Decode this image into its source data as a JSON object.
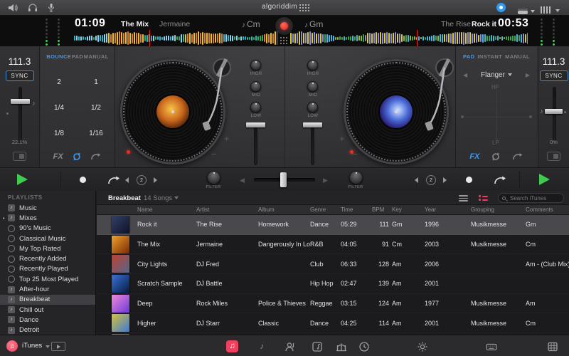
{
  "titlebar": {
    "logo_text": "algoriddim",
    "left_icons": [
      "volume-icon",
      "headphones-icon",
      "mic-icon"
    ],
    "right_icons": [
      "blue-status-icon",
      "deck-view-toggle-icon",
      "mixer-columns-icon"
    ]
  },
  "deck_a": {
    "elapsed": "01:09",
    "title": "The Mix",
    "artist": "Jermaine",
    "key": "Cm",
    "key_note": "♪",
    "bpm": "111.3",
    "sync_label": "SYNC",
    "pitch_percent": "22.1%",
    "pad_tabs": [
      "BOUNCE",
      "PAD",
      "MANUAL"
    ],
    "active_tab": "BOUNCE",
    "loop_grid": [
      "2",
      "1",
      "1/4",
      "1/2",
      "1/8",
      "1/16"
    ],
    "fx_label": "FX",
    "eq_labels": [
      "HIGH",
      "MID",
      "LOW"
    ],
    "filter_label": "FILTER",
    "beat_jump": "2",
    "pitch_plus": "+",
    "pitch_minus": "−"
  },
  "deck_b": {
    "remaining": "00:53",
    "title": "Rock it",
    "artist": "The Rise",
    "key": "Gm",
    "key_note": "♪",
    "bpm": "111.3",
    "sync_label": "SYNC",
    "pitch_percent": "0%",
    "fx_tabs": [
      "PAD",
      "INSTANT",
      "MANUAL"
    ],
    "active_tab": "PAD",
    "effect_name": "Flanger",
    "xy_pad_top": "HF",
    "xy_pad_bottom": "LP",
    "fx_label": "FX",
    "eq_labels": [
      "HIGH",
      "MID",
      "LOW"
    ],
    "filter_label": "FILTER",
    "beat_jump": "2",
    "pitch_plus": "+",
    "pitch_minus": "−"
  },
  "library": {
    "sidebar_header": "PLAYLISTS",
    "sidebar_items": [
      {
        "label": "Music",
        "icon": "playlist",
        "disclosure": false,
        "selected": false
      },
      {
        "label": "Mixes",
        "icon": "playlist",
        "disclosure": true,
        "selected": false
      },
      {
        "label": "90's Music",
        "icon": "smart",
        "disclosure": false,
        "selected": false
      },
      {
        "label": "Classical Music",
        "icon": "smart",
        "disclosure": false,
        "selected": false
      },
      {
        "label": "My Top Rated",
        "icon": "smart",
        "disclosure": false,
        "selected": false
      },
      {
        "label": "Recently Added",
        "icon": "smart",
        "disclosure": false,
        "selected": false
      },
      {
        "label": "Recently Played",
        "icon": "smart",
        "disclosure": false,
        "selected": false
      },
      {
        "label": "Top 25 Most Played",
        "icon": "smart",
        "disclosure": false,
        "selected": false
      },
      {
        "label": "After-hour",
        "icon": "playlist",
        "disclosure": false,
        "selected": false
      },
      {
        "label": "Breakbeat",
        "icon": "playlist",
        "disclosure": false,
        "selected": true
      },
      {
        "label": "Chill out",
        "icon": "playlist",
        "disclosure": false,
        "selected": false
      },
      {
        "label": "Dance",
        "icon": "playlist",
        "disclosure": false,
        "selected": false
      },
      {
        "label": "Detroit",
        "icon": "playlist",
        "disclosure": false,
        "selected": false
      }
    ],
    "source_label": "iTunes",
    "playlist_title": "Breakbeat",
    "playlist_count": "14 Songs",
    "search_placeholder": "Search iTunes",
    "columns": [
      "Name",
      "Artist",
      "Album",
      "Genre",
      "Time",
      "BPM",
      "Key",
      "Year",
      "Grouping",
      "Comments"
    ],
    "rows": [
      {
        "name": "Rock it",
        "artist": "The Rise",
        "album": "Homework",
        "genre": "Dance",
        "time": "05:29",
        "bpm": "111",
        "key": "Gm",
        "year": "1996",
        "grouping": "Musikmesse",
        "comments": "Gm",
        "selected": true,
        "art": [
          "#33406a",
          "#0d1226"
        ]
      },
      {
        "name": "The Mix",
        "artist": "Jermaine",
        "album": "Dangerously In Love",
        "genre": "R&B",
        "time": "04:05",
        "bpm": "91",
        "key": "Cm",
        "year": "2003",
        "grouping": "Musikmesse",
        "comments": "Cm",
        "selected": false,
        "art": [
          "#f0a02a",
          "#7a2a06"
        ]
      },
      {
        "name": "City Lights",
        "artist": "DJ Fred",
        "album": "",
        "genre": "Club",
        "time": "06:33",
        "bpm": "128",
        "key": "Am",
        "year": "2006",
        "grouping": "",
        "comments": "Am - (Club Mix)",
        "selected": false,
        "art": [
          "#c24030",
          "#52688c"
        ]
      },
      {
        "name": "Scratch Sample",
        "artist": "DJ Battle",
        "album": "",
        "genre": "Hip Hop",
        "time": "02:47",
        "bpm": "139",
        "key": "Am",
        "year": "2001",
        "grouping": "",
        "comments": "",
        "selected": false,
        "art": [
          "#3a72d8",
          "#081a40"
        ]
      },
      {
        "name": "Deep",
        "artist": "Rock Miles",
        "album": "Police & Thieves",
        "genre": "Reggae",
        "time": "03:15",
        "bpm": "124",
        "key": "Am",
        "year": "1977",
        "grouping": "Musikmesse",
        "comments": "Am",
        "selected": false,
        "art": [
          "#f08ad8",
          "#6a3ad8"
        ]
      },
      {
        "name": "Higher",
        "artist": "DJ Starr",
        "album": "Classic",
        "genre": "Dance",
        "time": "04:25",
        "bpm": "114",
        "key": "Am",
        "year": "2001",
        "grouping": "Musikmesse",
        "comments": "Cm",
        "selected": false,
        "art": [
          "#d8c23a",
          "#3a7ad8"
        ]
      },
      {
        "name": "",
        "artist": "",
        "album": "",
        "genre": "",
        "time": "",
        "bpm": "",
        "key": "",
        "year": "",
        "grouping": "",
        "comments": "",
        "selected": false,
        "art": [
          "#57a33b",
          "#2a7a5a"
        ]
      }
    ]
  },
  "bottom_toolbar": {
    "icons": [
      "media-library-icon",
      "songs-icon",
      "artists-icon",
      "albums-icon",
      "audio-fx-icon",
      "history-icon",
      "brightness-icon",
      "keyboard-icon",
      "grid-view-icon"
    ]
  },
  "colors": {
    "accent_blue": "#3a9af5",
    "record_red": "#e03226",
    "play_green": "#3ecb4e",
    "library_accent_pink": "#f0405e",
    "waveform_playhead": "#e8281e"
  }
}
